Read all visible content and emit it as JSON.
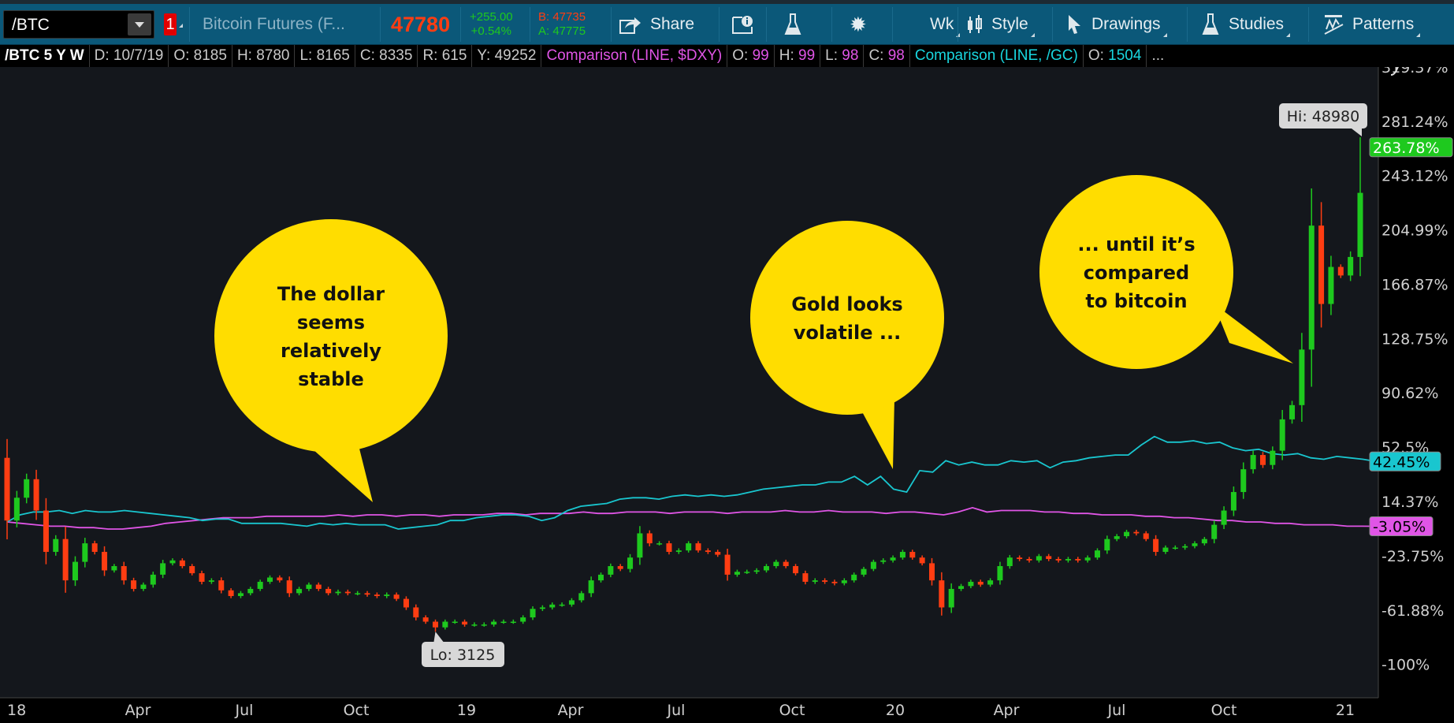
{
  "toolbar": {
    "symbol": "/BTC",
    "link_badge": "1",
    "description": "Bitcoin Futures (F...",
    "last": "47780",
    "change": "+255.00",
    "change_pct": "+0.54%",
    "bid": "B: 47735",
    "ask": "A: 47775",
    "share": "Share",
    "timeframe": "Wk",
    "style": "Style",
    "drawings": "Drawings",
    "studies": "Studies",
    "patterns": "Patterns",
    "icons": [
      "share-icon",
      "product-info-icon",
      "flask-icon",
      "gear-icon",
      "candle-style-icon",
      "cursor-arrow-icon",
      "studies-flask-icon",
      "patterns-icon"
    ]
  },
  "infobar": {
    "title": "/BTC 5 Y W",
    "d": "D: 10/7/19",
    "o": "O: 8185",
    "h": "H: 8780",
    "l": "L: 8165",
    "c": "C: 8335",
    "r": "R: 615",
    "y": "Y: 49252",
    "cmp1": {
      "label": "Comparison (LINE, $DXY)",
      "o_k": "O:",
      "o": "99",
      "h_k": "H:",
      "h": "99",
      "l_k": "L:",
      "l": "98",
      "c_k": "C:",
      "c": "98"
    },
    "cmp2": {
      "label": "Comparison (LINE, /GC)",
      "o_k": "O:",
      "o": "1504"
    },
    "more": "..."
  },
  "colors": {
    "up": "#1ec91e",
    "down": "#ff3d12",
    "dxy": "#e055e6",
    "gc": "#19c6cf",
    "bubble": "#ffdd00",
    "toolbar": "#0b5879"
  },
  "chart_data": {
    "type": "candlestick",
    "ylabel_unit": "%",
    "y_ticks": [
      "319.37%",
      "281.24%",
      "243.12%",
      "204.99%",
      "166.87%",
      "128.75%",
      "90.62%",
      "52.5%",
      "14.37%",
      "-23.75%",
      "-61.88%",
      "-100%"
    ],
    "y_tick_values": [
      319.37,
      281.24,
      243.12,
      204.99,
      166.87,
      128.75,
      90.62,
      52.5,
      14.37,
      -23.75,
      -61.88,
      -100
    ],
    "x_ticks": [
      "18",
      "Apr",
      "Jul",
      "Oct",
      "19",
      "Apr",
      "Jul",
      "Oct",
      "20",
      "Apr",
      "Jul",
      "Oct",
      "21"
    ],
    "btc": {
      "first_open": 45,
      "last_high": 270,
      "lo_low": -77,
      "closes": [
        1,
        17,
        30,
        8,
        -21,
        -12,
        -41,
        -28,
        -15,
        -21,
        -34,
        -31,
        -41,
        -47,
        -44,
        -37,
        -29,
        -27,
        -31,
        -36,
        -42,
        -41,
        -48,
        -52,
        -50,
        -47,
        -42,
        -39,
        -41,
        -50,
        -47,
        -44,
        -47,
        -50,
        -49,
        -50,
        -50,
        -51,
        -52,
        -51,
        -54,
        -60,
        -67,
        -70,
        -74,
        -70,
        -70,
        -72,
        -72,
        -72,
        -70,
        -70,
        -70,
        -67,
        -61,
        -60,
        -58,
        -58,
        -55,
        -50,
        -41,
        -37,
        -31,
        -33,
        -25,
        -8,
        -15,
        -15,
        -21,
        -20,
        -15,
        -20,
        -21,
        -23,
        -37,
        -35,
        -35,
        -34,
        -31,
        -28,
        -31,
        -36,
        -42,
        -41,
        -42,
        -43,
        -41,
        -37,
        -33,
        -28,
        -27,
        -25,
        -21,
        -25,
        -29,
        -41,
        -60,
        -47,
        -45,
        -42,
        -44,
        -41,
        -31,
        -25,
        -26,
        -27,
        -24,
        -26,
        -27,
        -26,
        -27,
        -25,
        -20,
        -12,
        -10,
        -7,
        -8,
        -12,
        -21,
        -18,
        -18,
        -17,
        -15,
        -12,
        -2,
        8,
        21,
        37,
        47,
        40,
        50,
        72,
        82,
        121,
        208,
        153,
        179,
        173,
        186,
        231
      ]
    },
    "dxy": {
      "name": "Comparison (LINE, $DXY)",
      "values": [
        0,
        -1,
        -2,
        -3,
        -3,
        -4,
        -4,
        -5,
        -5,
        -4,
        -3,
        -1,
        0,
        1,
        2,
        3,
        3,
        3,
        4,
        4,
        4,
        4,
        4,
        5,
        4,
        5,
        5,
        4,
        5,
        5,
        4,
        5,
        5,
        5,
        6,
        6,
        5,
        6,
        6,
        6,
        7,
        6,
        6,
        7,
        7,
        7,
        6,
        7,
        7,
        7,
        6,
        7,
        7,
        7,
        8,
        7,
        7,
        8,
        7,
        7,
        7,
        6,
        7,
        7,
        6,
        5,
        7,
        10,
        7,
        8,
        8,
        8,
        7,
        7,
        6,
        6,
        5,
        5,
        5,
        4,
        4,
        3,
        3,
        2,
        1,
        1,
        0,
        0,
        -1,
        -1,
        -2,
        -2,
        -2,
        -3,
        -3,
        -3.05
      ]
    },
    "gc": {
      "name": "Comparison (LINE, /GC)",
      "values": [
        0,
        5,
        7,
        7,
        8,
        6,
        8,
        7,
        7,
        8,
        7,
        6,
        5,
        4,
        3,
        1,
        2,
        2,
        -1,
        -1,
        -1,
        -1,
        -2,
        -3,
        -1,
        -2,
        -1,
        -2,
        -2,
        -2,
        -5,
        -4,
        -3,
        -2,
        1,
        1,
        3,
        4,
        5,
        5,
        4,
        1,
        3,
        8,
        11,
        12,
        13,
        16,
        17,
        17,
        16,
        18,
        19,
        18,
        19,
        18,
        19,
        21,
        23,
        24,
        25,
        26,
        26,
        28,
        28,
        32,
        26,
        32,
        23,
        21,
        36,
        35,
        43,
        40,
        42,
        40,
        40,
        43,
        42,
        43,
        38,
        42,
        43,
        45,
        46,
        47,
        47,
        54,
        60,
        56,
        56,
        57,
        55,
        56,
        52,
        50,
        51,
        48,
        47,
        48,
        45,
        44,
        46,
        45,
        44,
        42.45
      ]
    },
    "last_labels": {
      "btc": "263.78%",
      "gc": "42.45%",
      "dxy": "-3.05%"
    },
    "hi_label": "Hi: 48980",
    "lo_label": "Lo: 3125",
    "annotations": [
      {
        "lines": [
          "The dollar",
          "seems",
          "relatively",
          "stable"
        ]
      },
      {
        "lines": [
          "Gold looks",
          "volatile ..."
        ]
      },
      {
        "lines": [
          "... until it’s",
          "compared",
          "to bitcoin"
        ]
      }
    ],
    "grid": false
  }
}
